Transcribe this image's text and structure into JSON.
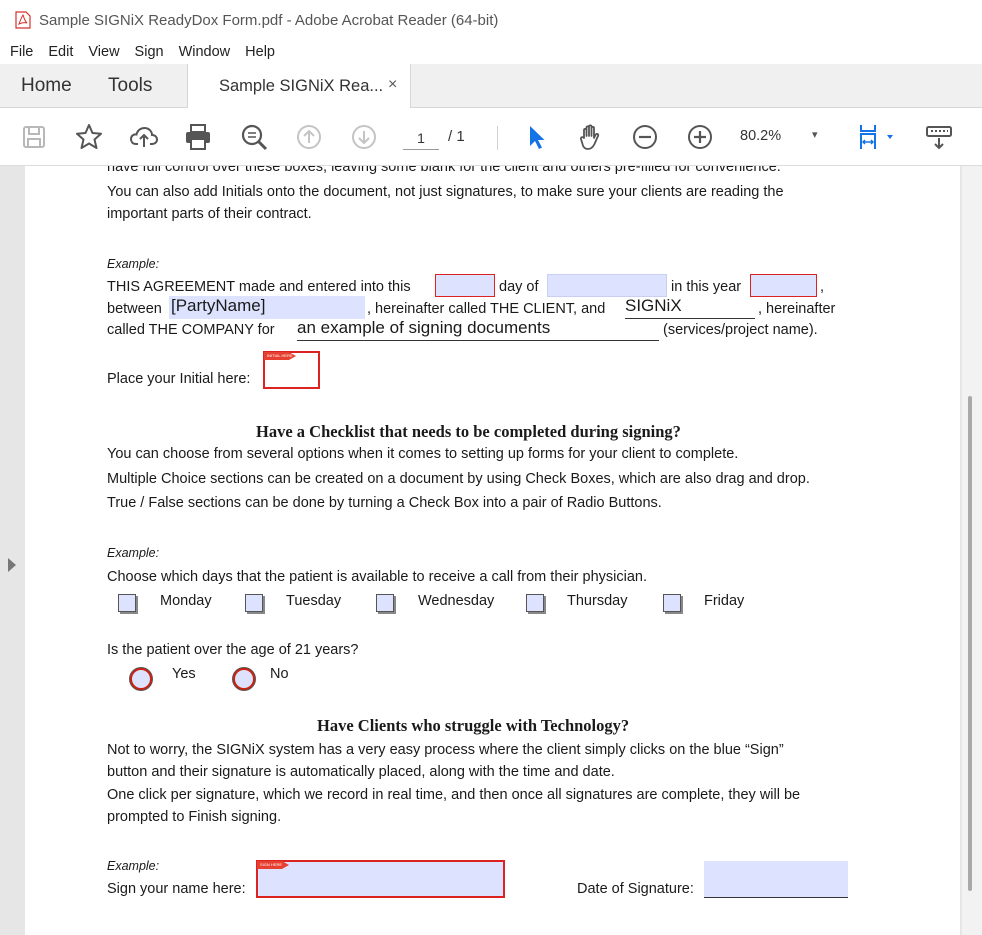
{
  "window": {
    "title": "Sample SIGNiX ReadyDox Form.pdf - Adobe Acrobat Reader (64-bit)"
  },
  "menu": [
    "File",
    "Edit",
    "View",
    "Sign",
    "Window",
    "Help"
  ],
  "tabs": {
    "home": "Home",
    "tools": "Tools",
    "document": "Sample SIGNiX Rea...",
    "close": "×"
  },
  "toolbar": {
    "page_current": "1",
    "page_total": "/ 1",
    "zoom": "80.2%",
    "zoom_caret": "▾"
  },
  "doc": {
    "intro_line1": "have full control over these boxes, leaving some blank for the client and others pre-filled for convenience.",
    "intro_line2": "You can also add Initials onto the document, not just signatures, to make sure your clients are reading the",
    "intro_line3": "important parts of their contract.",
    "example_label": "Example:",
    "agreement_a": "THIS AGREEMENT made and entered into this",
    "agreement_b": "day of",
    "agreement_c": "in this year",
    "agreement_d": ",",
    "between": "between",
    "party_name": "[PartyName]",
    "hereinafter_client": ", hereinafter called THE CLIENT, and",
    "company_name": "SIGNiX",
    "hereinafter": ", hereinafter",
    "called_company": "called THE COMPANY for",
    "services_value": "an example of signing documents",
    "services_label": "(services/project name).",
    "initial_label": "Place your Initial here:",
    "sig_tag": "INITIAL HERE",
    "checklist_heading": "Have a Checklist that needs to be completed during signing?",
    "checklist_line1": "You can choose from several options when it comes to setting up forms for your client to complete.",
    "checklist_line2": "Multiple Choice sections can be created on a document by using Check Boxes, which are also drag and drop.",
    "checklist_line3": "True / False sections can be done by turning a Check Box into a pair of Radio Buttons.",
    "days_question": "Choose which days that the patient is available to receive a call from their physician.",
    "days": [
      "Monday",
      "Tuesday",
      "Wednesday",
      "Thursday",
      "Friday"
    ],
    "age_question": "Is the patient over the age of 21 years?",
    "yes": "Yes",
    "no": "No",
    "tech_heading": "Have Clients who struggle with Technology?",
    "tech_line1": "Not to worry, the SIGNiX system has a very easy process where the client simply clicks on the blue “Sign”",
    "tech_line2": "button and their signature is automatically placed, along with the time and date.",
    "tech_line3": "One click per signature, which we record in real time, and then once all signatures are complete, they will be",
    "tech_line4": "prompted to Finish signing.",
    "sign_label": "Sign your name here:",
    "sign_tag": "SIGN HERE",
    "date_label": "Date of Signature:"
  }
}
